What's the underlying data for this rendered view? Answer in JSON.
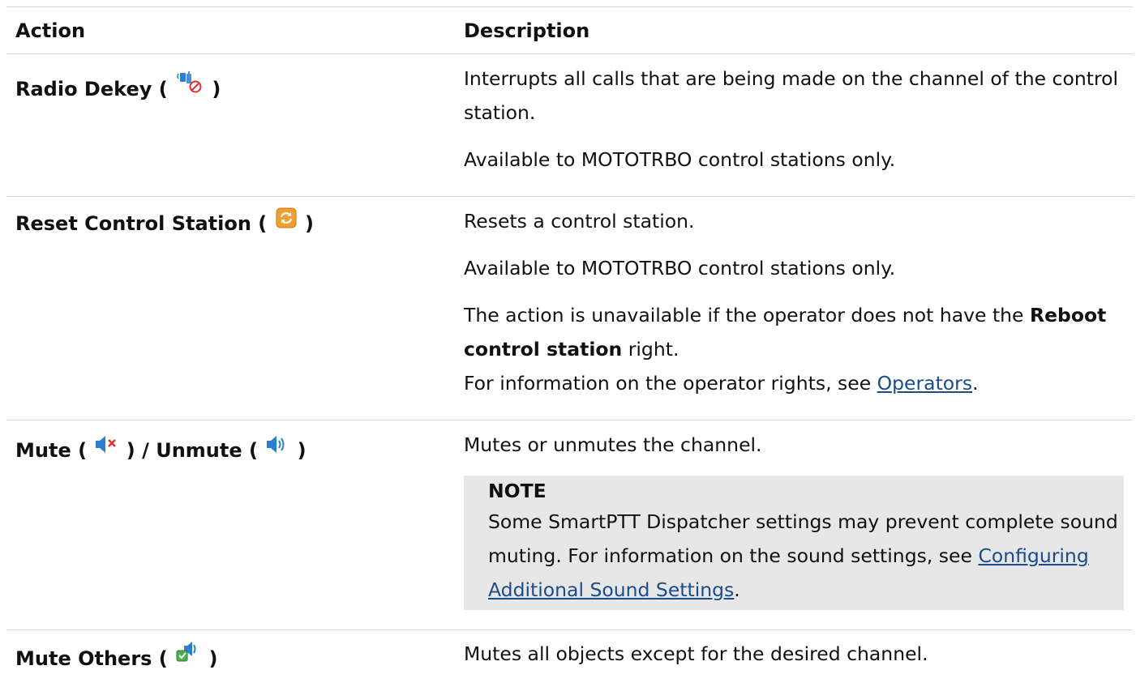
{
  "header": {
    "action": "Action",
    "description": "Description"
  },
  "rows": [
    {
      "action_label": "Radio Dekey (",
      "action_close": ")",
      "icon": "radio-dekey-icon",
      "desc": [
        "Interrupts all calls that are being made on the channel of the control station.",
        "Available to MOTOTRBO control stations only."
      ]
    },
    {
      "action_label": "Reset Control Station (",
      "action_close": ")",
      "icon": "refresh-icon",
      "desc": [
        "Resets a control station.",
        "Available to MOTOTRBO control stations only."
      ],
      "rights": {
        "pre": "The action is unavailable if the operator does not have the",
        "bold": "Reboot control station",
        "post": " right.",
        "info_pre": "For information on the operator rights, see ",
        "link": "Operators",
        "info_post": "."
      }
    },
    {
      "action_mute": "Mute (",
      "action_mid": ") / Unmute (",
      "action_close": ")",
      "icons": [
        "speaker-muted-icon",
        "speaker-icon"
      ],
      "desc": [
        "Mutes or unmutes the channel."
      ],
      "note": {
        "title": "NOTE",
        "pre": "Some SmartPTT Dispatcher settings may prevent complete sound muting. For information on the sound settings, see ",
        "link": "Configuring Additional Sound Settings",
        "post": "."
      }
    },
    {
      "action_label": "Mute Others (",
      "action_close": ")",
      "icon": "mute-others-icon",
      "desc": [
        "Mutes all objects except for the desired channel."
      ]
    }
  ],
  "colors": {
    "link": "#1a4c8c",
    "note_bg": "#e7e7e7",
    "rule": "#d4d4d4",
    "reset_icon": "#f0a030",
    "speaker_icon": "#2a7fd0",
    "mute_x": "#e03030"
  }
}
